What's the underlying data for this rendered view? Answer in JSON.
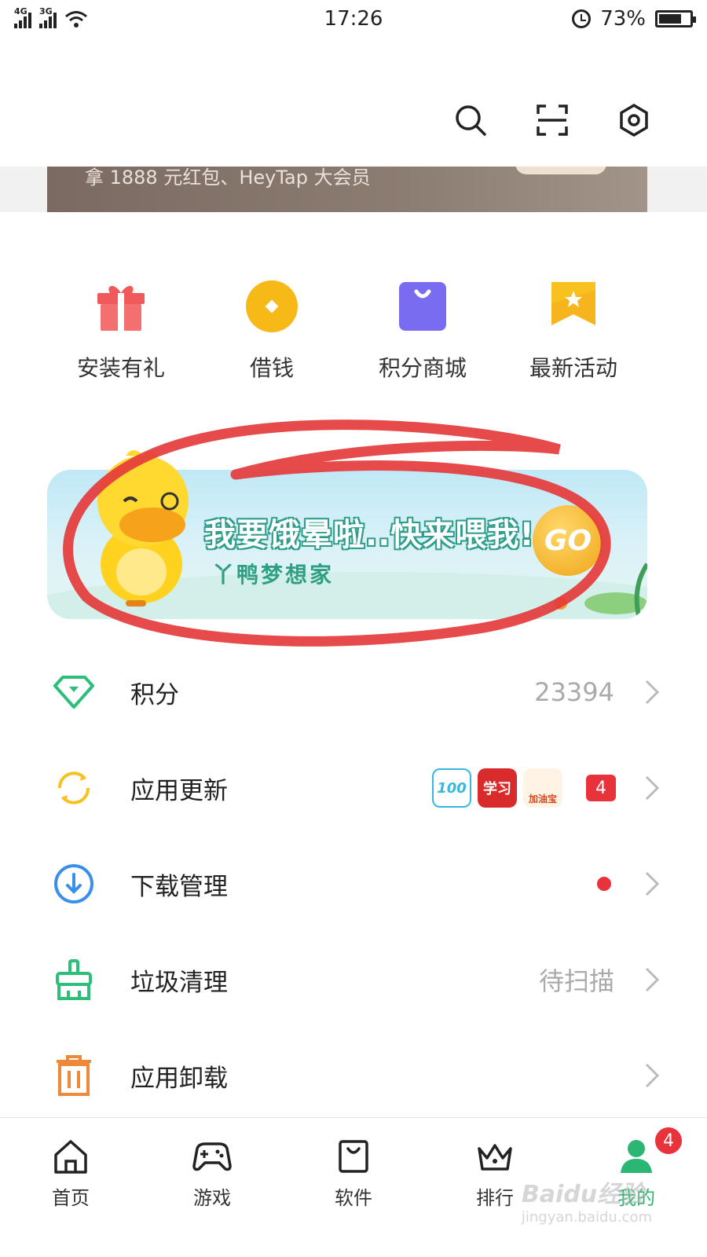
{
  "status_bar": {
    "network_1": "4G",
    "network_2": "3G",
    "time": "17:26",
    "battery": "73%",
    "battery_level": 0.73
  },
  "header": {
    "icons": [
      "search-icon",
      "scan-icon",
      "settings-icon"
    ]
  },
  "promo": {
    "text": "拿 1888 元红包、HeyTap 大会员"
  },
  "quick_actions": [
    {
      "label": "安装有礼",
      "icon": "gift-icon",
      "color": "#f05a5a"
    },
    {
      "label": "借钱",
      "icon": "coin-icon",
      "color": "#f7b918"
    },
    {
      "label": "积分商城",
      "icon": "shopping-bag-icon",
      "color": "#7a6cf0"
    },
    {
      "label": "最新活动",
      "icon": "star-flag-icon",
      "color": "#f7c21f"
    }
  ],
  "banner": {
    "title": "我要饿晕啦..快来喂我!",
    "subtitle": "丫鸭梦想家",
    "coin_text": "GO"
  },
  "list": {
    "points": {
      "label": "积分",
      "value": "23394"
    },
    "updates": {
      "label": "应用更新",
      "apps": [
        {
          "name": "100",
          "color": "#37b8e0"
        },
        {
          "name": "学习",
          "color": "#d92b2b"
        },
        {
          "name": "加油宝",
          "color": "#f08a2c"
        }
      ],
      "badge": "4"
    },
    "downloads": {
      "label": "下载管理"
    },
    "cleanup": {
      "label": "垃圾清理",
      "value": "待扫描"
    },
    "uninstall": {
      "label": "应用卸载"
    }
  },
  "bottom_nav": {
    "items": [
      {
        "label": "首页",
        "icon": "home-icon"
      },
      {
        "label": "游戏",
        "icon": "gamepad-icon"
      },
      {
        "label": "软件",
        "icon": "bag-icon"
      },
      {
        "label": "排行",
        "icon": "crown-icon"
      },
      {
        "label": "我的",
        "icon": "user-icon"
      }
    ],
    "my_badge": "4"
  },
  "watermark": {
    "brand": "Baidu经验",
    "url": "jingyan.baidu.com"
  },
  "colors": {
    "accent_green": "#2bb673",
    "badge_red": "#e8323c",
    "annotation_red": "#e53b3b"
  }
}
